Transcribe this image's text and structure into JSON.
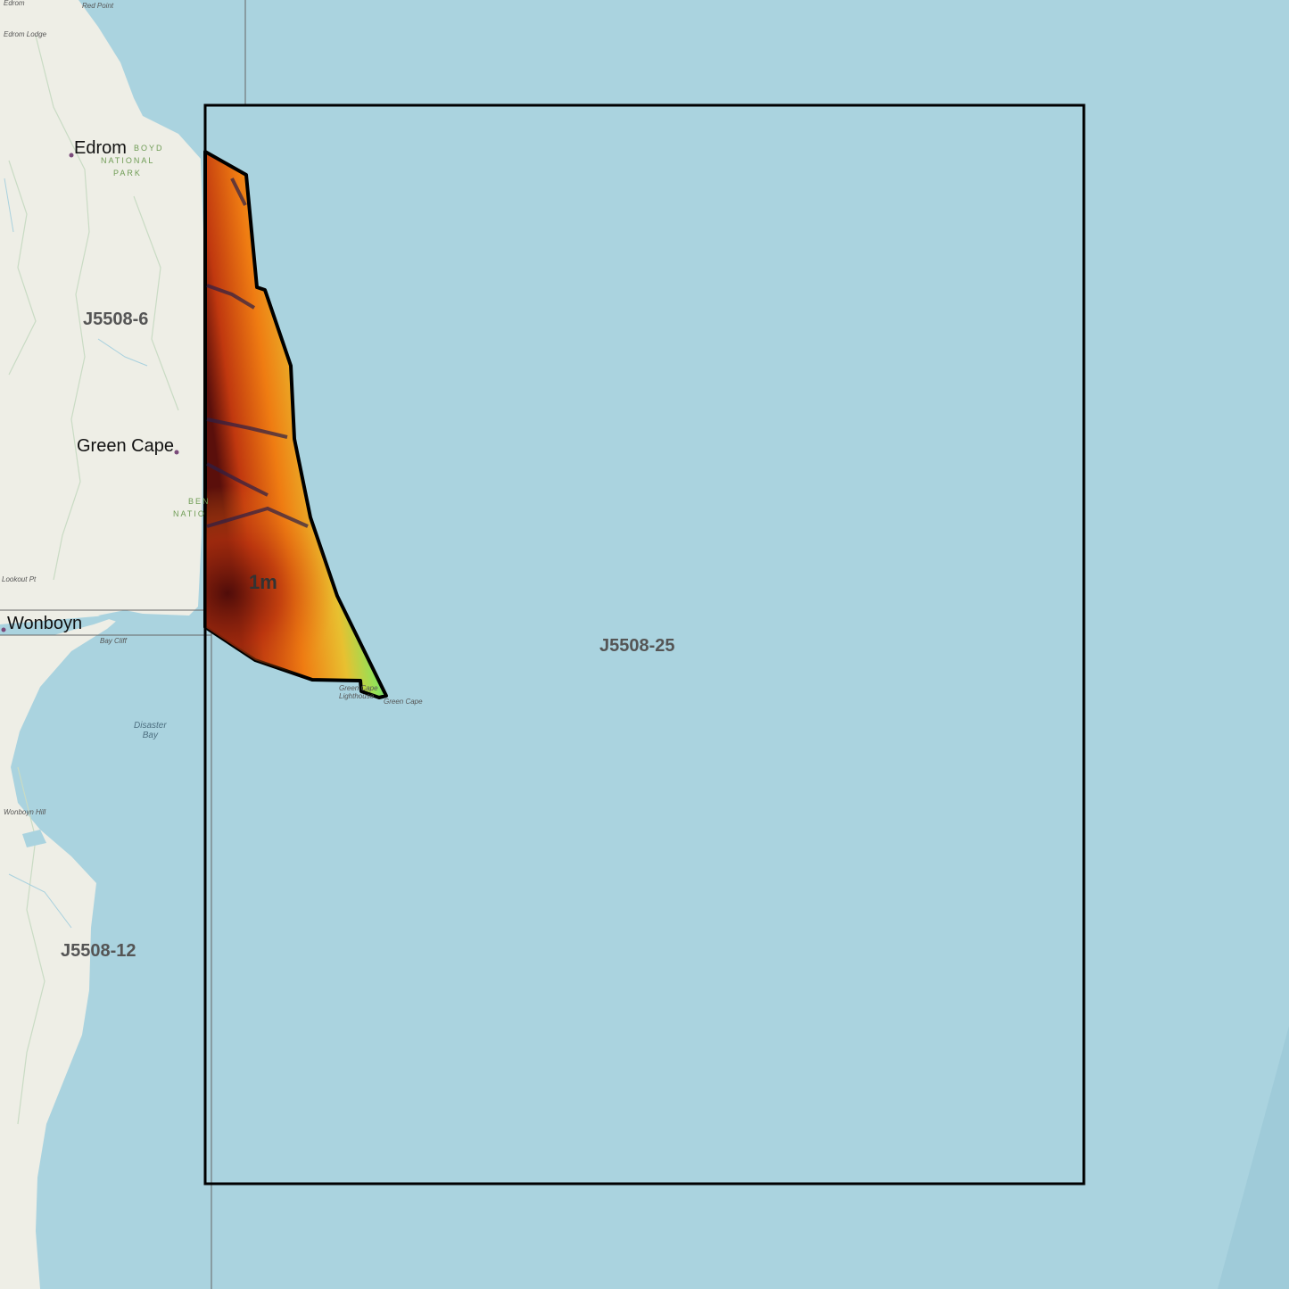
{
  "map": {
    "colors": {
      "water": "#aad3df",
      "land": "#eeeee6",
      "elevation_low": "#2b1f47",
      "elevation_high": "#7a1a10",
      "outline": "#000000"
    },
    "places": [
      {
        "name": "Edrom"
      },
      {
        "name": "Green Cape"
      },
      {
        "name": "Wonboyn"
      }
    ],
    "tiles": [
      {
        "label": "J5508-6"
      },
      {
        "label": "J5508-12"
      },
      {
        "label": "J5508-25"
      }
    ],
    "resolution_label": "1m",
    "park_labels": [
      "BOYD",
      "NATIONAL",
      "PARK",
      "BEN",
      "NATIO"
    ],
    "minor_labels": [
      "Red Point",
      "Edrom",
      "Edrom Lodge",
      "Lookout Pt",
      "Bay Cliff",
      "Green Cape",
      "Green Cape Lighthouse",
      "Wonboyn Hill"
    ],
    "water_labels": [
      "Disaster",
      "Bay"
    ]
  }
}
